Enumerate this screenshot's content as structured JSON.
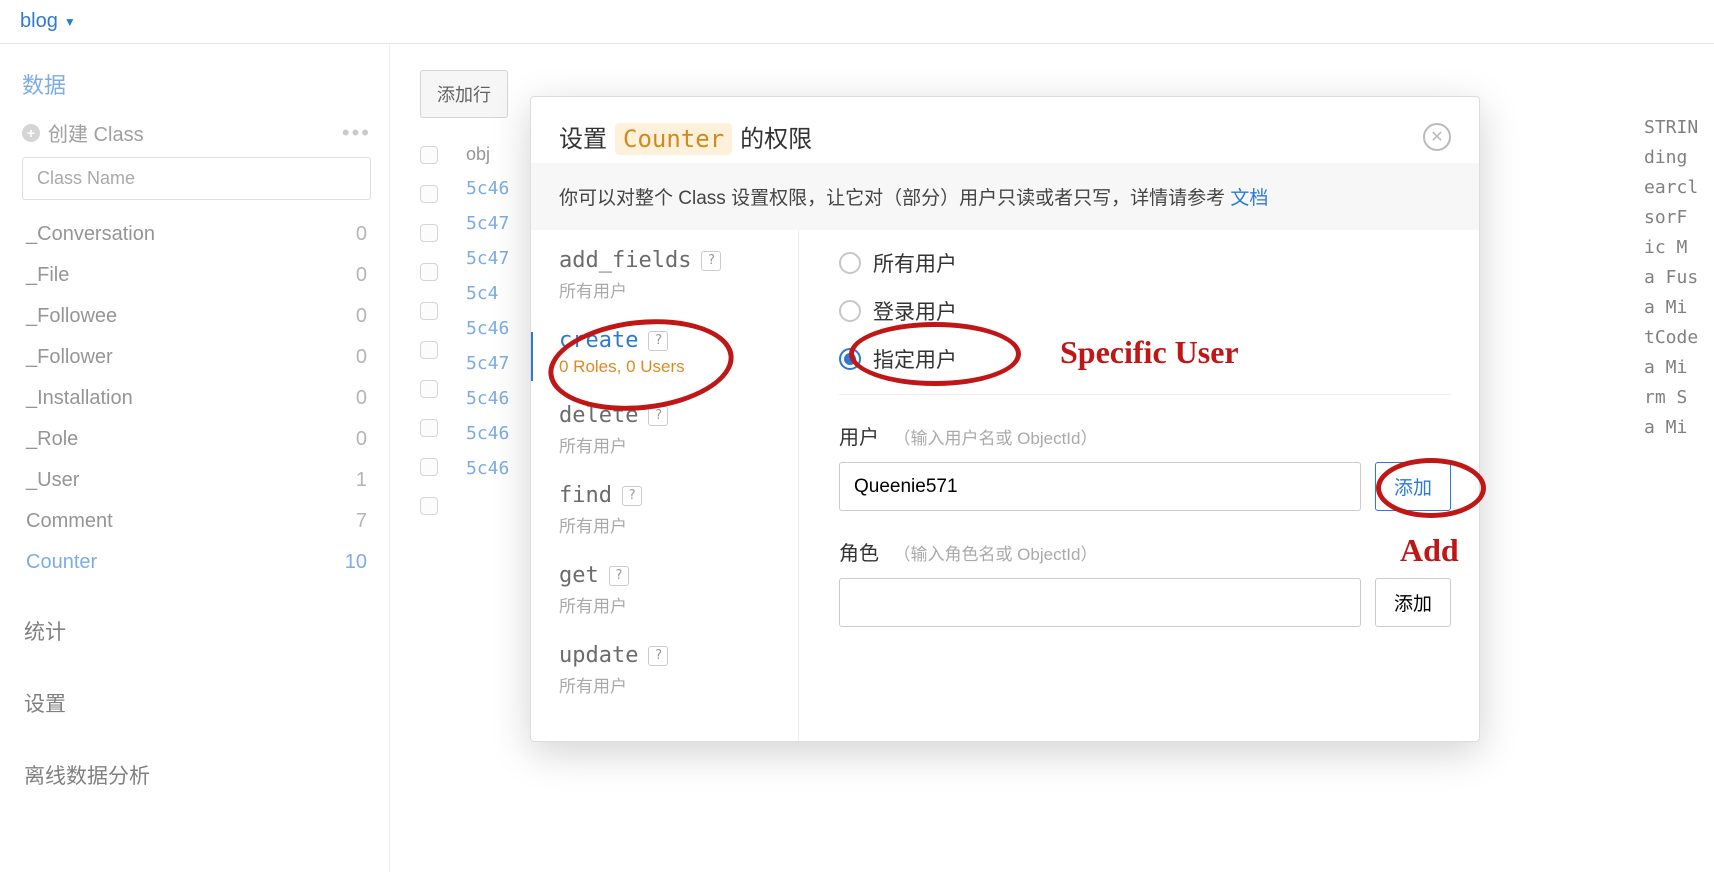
{
  "header": {
    "app_name": "blog"
  },
  "sidebar": {
    "section_data": "数据",
    "create_class_label": "创建 Class",
    "classname_placeholder": "Class Name",
    "classes": [
      {
        "name": "_Conversation",
        "count": "0"
      },
      {
        "name": "_File",
        "count": "0"
      },
      {
        "name": "_Followee",
        "count": "0"
      },
      {
        "name": "_Follower",
        "count": "0"
      },
      {
        "name": "_Installation",
        "count": "0"
      },
      {
        "name": "_Role",
        "count": "0"
      },
      {
        "name": "_User",
        "count": "1"
      },
      {
        "name": "Comment",
        "count": "7"
      },
      {
        "name": "Counter",
        "count": "10",
        "active": true
      }
    ],
    "nav": {
      "stats": "统计",
      "settings": "设置",
      "offline": "离线数据分析"
    }
  },
  "content": {
    "add_row_label": "添加行",
    "obj_header": "obj",
    "id_prefixes": [
      "5c46",
      "5c47",
      "5c47",
      "5c4",
      "5c46",
      "5c47",
      "5c46",
      "5c46",
      "5c46"
    ],
    "right_col_header": "STRIN",
    "right_col_vals": [
      "ding",
      "earcl",
      "sorF",
      "ic M",
      "a Fus",
      "a Mi",
      "tCode",
      "a Mi",
      "rm S",
      "a Mi"
    ]
  },
  "modal": {
    "title_prefix": "设置",
    "title_counter": "Counter",
    "title_suffix": "的权限",
    "desc_text": "你可以对整个 Class 设置权限，让它对（部分）用户只读或者只写，详情请参考 ",
    "desc_link": "文档",
    "permissions": [
      {
        "key": "add_fields",
        "sub": "所有用户"
      },
      {
        "key": "create",
        "sub": "0 Roles, 0 Users"
      },
      {
        "key": "delete",
        "sub": "所有用户"
      },
      {
        "key": "find",
        "sub": "所有用户"
      },
      {
        "key": "get",
        "sub": "所有用户"
      },
      {
        "key": "update",
        "sub": "所有用户"
      }
    ],
    "radios": {
      "all_users": "所有用户",
      "logged_in": "登录用户",
      "specific": "指定用户"
    },
    "user_field": {
      "label": "用户",
      "hint": "（输入用户名或 ObjectId）",
      "value": "Queenie571",
      "add": "添加"
    },
    "role_field": {
      "label": "角色",
      "hint": "（输入角色名或 ObjectId）",
      "add": "添加"
    }
  },
  "annotations": {
    "specific_user": "Specific User",
    "add": "Add"
  }
}
